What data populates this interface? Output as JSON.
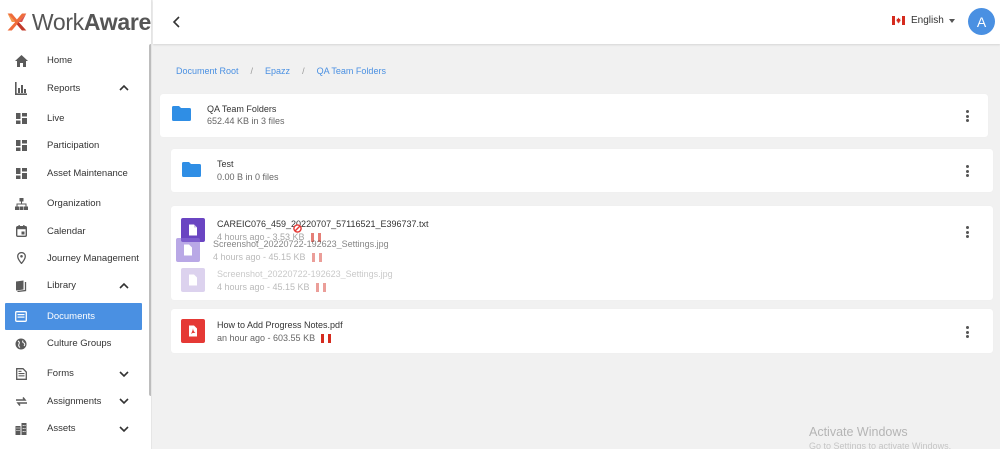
{
  "app": {
    "brand_light": "Work",
    "brand_bold": "Aware"
  },
  "sidebar": {
    "items": [
      {
        "label": "Home",
        "icon": "home-icon"
      },
      {
        "label": "Reports",
        "icon": "reports-icon"
      },
      {
        "label": "Live",
        "icon": "dashboard-icon"
      },
      {
        "label": "Participation",
        "icon": "dashboard-icon"
      },
      {
        "label": "Asset Maintenance",
        "icon": "dashboard-icon"
      },
      {
        "label": "Organization",
        "icon": "org-chart-icon"
      },
      {
        "label": "Calendar",
        "icon": "calendar-icon"
      },
      {
        "label": "Journey Management",
        "icon": "map-pin-icon"
      },
      {
        "label": "Library",
        "icon": "book-icon"
      },
      {
        "label": "Documents",
        "icon": "document-icon"
      },
      {
        "label": "Culture Groups",
        "icon": "globe-icon"
      },
      {
        "label": "Forms",
        "icon": "forms-icon"
      },
      {
        "label": "Assignments",
        "icon": "sync-icon"
      },
      {
        "label": "Assets",
        "icon": "building-icon"
      }
    ]
  },
  "topbar": {
    "language": "English",
    "avatar_initial": "A"
  },
  "breadcrumb": {
    "items": [
      "Document Root",
      "Epazz",
      "QA Team Folders"
    ],
    "separator": "/"
  },
  "folders": [
    {
      "name": "QA Team Folders",
      "meta": "652.44 KB in 3 files"
    },
    {
      "name": "Test",
      "meta": "0.00 B in 0 files"
    }
  ],
  "files": {
    "group_file": {
      "name": "CAREIC076_459_20220707_57116521_E396737.txt",
      "meta": "4 hours ago - 3.53 KB"
    },
    "drag_ghost": {
      "name": "Screenshot_20220722-192623_Settings.jpg",
      "meta": "4 hours ago - 45.15 KB"
    },
    "ghost_file": {
      "name": "Screenshot_20220722-192623_Settings.jpg",
      "meta": "4 hours ago - 45.15 KB"
    },
    "pdf_file": {
      "name": "How to Add Progress Notes.pdf",
      "meta": "an hour ago - 603.55 KB"
    }
  },
  "colors": {
    "accent": "#4a90e2",
    "folder": "#2f8ee5",
    "txt_icon": "#6a45c2",
    "pdf_icon": "#e53935",
    "img_icon": "#b39ddb",
    "flag_red": "#d52b1e"
  },
  "watermark": {
    "title": "Activate Windows",
    "subtitle": "Go to Settings to activate Windows."
  }
}
